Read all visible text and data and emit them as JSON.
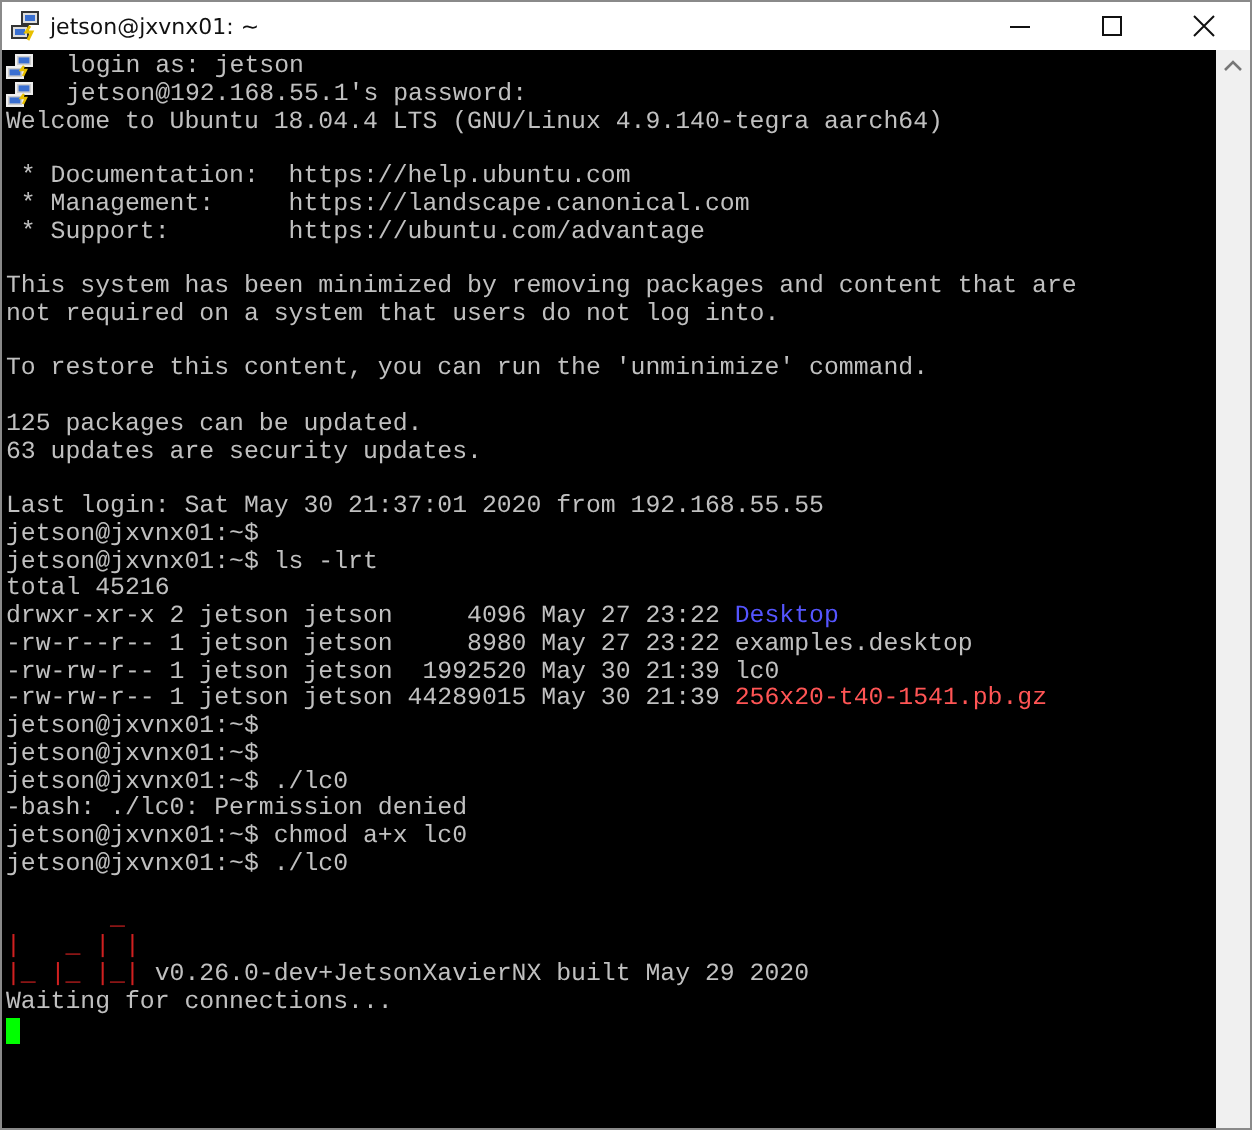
{
  "window": {
    "title": "jetson@jxvnx01: ~"
  },
  "terminal": {
    "lines": [
      {
        "kind": "notice",
        "segments": [
          {
            "kind": "text",
            "text": "login as: jetson"
          }
        ]
      },
      {
        "kind": "notice",
        "segments": [
          {
            "kind": "text",
            "text": "jetson@192.168.55.1's password:"
          }
        ]
      },
      {
        "kind": "output",
        "segments": [
          {
            "kind": "text",
            "text": "Welcome to Ubuntu 18.04.4 LTS (GNU/Linux 4.9.140-tegra aarch64)"
          }
        ]
      },
      {
        "kind": "blank"
      },
      {
        "kind": "output",
        "segments": [
          {
            "kind": "text",
            "text": " * Documentation:  https://help.ubuntu.com"
          }
        ]
      },
      {
        "kind": "output",
        "segments": [
          {
            "kind": "text",
            "text": " * Management:     https://landscape.canonical.com"
          }
        ]
      },
      {
        "kind": "output",
        "segments": [
          {
            "kind": "text",
            "text": " * Support:        https://ubuntu.com/advantage"
          }
        ]
      },
      {
        "kind": "blank"
      },
      {
        "kind": "output",
        "segments": [
          {
            "kind": "text",
            "text": "This system has been minimized by removing packages and content that are"
          }
        ]
      },
      {
        "kind": "output",
        "segments": [
          {
            "kind": "text",
            "text": "not required on a system that users do not log into."
          }
        ]
      },
      {
        "kind": "blank"
      },
      {
        "kind": "output",
        "segments": [
          {
            "kind": "text",
            "text": "To restore this content, you can run the 'unminimize' command."
          }
        ]
      },
      {
        "kind": "blank"
      },
      {
        "kind": "output",
        "segments": [
          {
            "kind": "text",
            "text": "125 packages can be updated."
          }
        ]
      },
      {
        "kind": "output",
        "segments": [
          {
            "kind": "text",
            "text": "63 updates are security updates."
          }
        ]
      },
      {
        "kind": "blank"
      },
      {
        "kind": "output",
        "segments": [
          {
            "kind": "text",
            "text": "Last login: Sat May 30 21:37:01 2020 from 192.168.55.55"
          }
        ]
      },
      {
        "kind": "output",
        "segments": [
          {
            "kind": "text",
            "text": "jetson@jxvnx01:~$"
          }
        ]
      },
      {
        "kind": "output",
        "segments": [
          {
            "kind": "text",
            "text": "jetson@jxvnx01:~$ ls -lrt"
          }
        ]
      },
      {
        "kind": "output",
        "segments": [
          {
            "kind": "text",
            "text": "total 45216"
          }
        ]
      },
      {
        "kind": "output",
        "segments": [
          {
            "kind": "text",
            "text": "drwxr-xr-x 2 jetson jetson     4096 May 27 23:22 "
          },
          {
            "kind": "directory",
            "text": "Desktop"
          }
        ]
      },
      {
        "kind": "output",
        "segments": [
          {
            "kind": "text",
            "text": "-rw-r--r-- 1 jetson jetson     8980 May 27 23:22 examples.desktop"
          }
        ]
      },
      {
        "kind": "output",
        "segments": [
          {
            "kind": "text",
            "text": "-rw-rw-r-- 1 jetson jetson  1992520 May 30 21:39 lc0"
          }
        ]
      },
      {
        "kind": "output",
        "segments": [
          {
            "kind": "text",
            "text": "-rw-rw-r-- 1 jetson jetson 44289015 May 30 21:39 "
          },
          {
            "kind": "archive",
            "text": "256x20-t40-1541.pb.gz"
          }
        ]
      },
      {
        "kind": "output",
        "segments": [
          {
            "kind": "text",
            "text": "jetson@jxvnx01:~$"
          }
        ]
      },
      {
        "kind": "output",
        "segments": [
          {
            "kind": "text",
            "text": "jetson@jxvnx01:~$"
          }
        ]
      },
      {
        "kind": "output",
        "segments": [
          {
            "kind": "text",
            "text": "jetson@jxvnx01:~$ ./lc0"
          }
        ]
      },
      {
        "kind": "output",
        "segments": [
          {
            "kind": "text",
            "text": "-bash: ./lc0: Permission denied"
          }
        ]
      },
      {
        "kind": "output",
        "segments": [
          {
            "kind": "text",
            "text": "jetson@jxvnx01:~$ chmod a+x lc0"
          }
        ]
      },
      {
        "kind": "output",
        "segments": [
          {
            "kind": "text",
            "text": "jetson@jxvnx01:~$ ./lc0"
          }
        ]
      },
      {
        "kind": "blank"
      },
      {
        "kind": "output",
        "segments": [
          {
            "kind": "logo",
            "text": "       _"
          }
        ]
      },
      {
        "kind": "output",
        "segments": [
          {
            "kind": "logo",
            "text": "|   _ | |"
          }
        ]
      },
      {
        "kind": "output",
        "segments": [
          {
            "kind": "logo",
            "text": "|_ |_ |_|"
          },
          {
            "kind": "text",
            "text": " v0.26.0-dev+JetsonXavierNX built May 29 2020"
          }
        ]
      },
      {
        "kind": "output",
        "segments": [
          {
            "kind": "text",
            "text": "Waiting for connections..."
          }
        ]
      },
      {
        "kind": "cursor"
      }
    ]
  }
}
